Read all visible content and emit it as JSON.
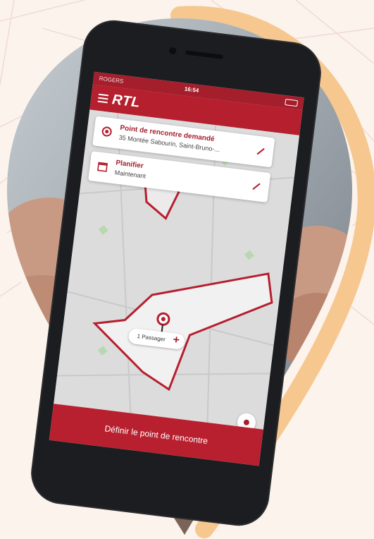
{
  "status_bar": {
    "carrier": "ROGERS",
    "time": "16:54"
  },
  "app": {
    "brand": "RTL"
  },
  "cards": [
    {
      "title": "Point de rencontre demandé",
      "subtitle": "35 Montée Sabourin, Saint-Bruno-..."
    },
    {
      "title": "Planifier",
      "subtitle": "Maintenant"
    }
  ],
  "passenger_pill": {
    "label": "1 Passager",
    "plus": "+"
  },
  "cta": {
    "label": "Définir le point de rencontre"
  },
  "colors": {
    "accent_red": "#b51f2e",
    "accent_orange": "#f6c890",
    "background": "#fbf3ec"
  }
}
